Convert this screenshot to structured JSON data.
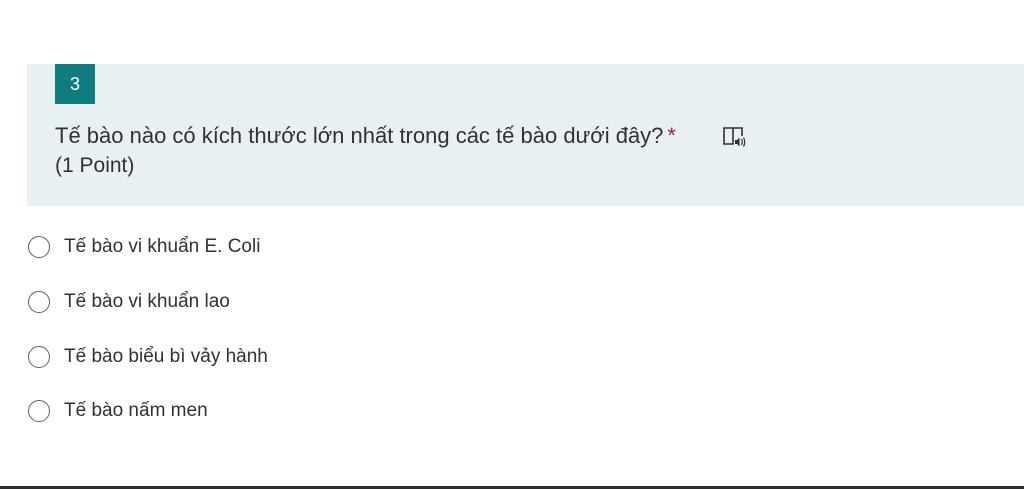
{
  "question": {
    "number": "3",
    "title": "Tế bào nào có kích thước lớn nhất trong các tế bào dưới đây?",
    "required_mark": "*",
    "points": "(1 Point)",
    "reader_icon": "immersive-reader-icon"
  },
  "options": [
    {
      "label": "Tế bào vi khuẩn E. Coli",
      "selected": false
    },
    {
      "label": "Tế bào vi khuẩn lao",
      "selected": false
    },
    {
      "label": "Tế bào biểu bì vảy hành",
      "selected": false
    },
    {
      "label": "Tế bào nấm men",
      "selected": false
    }
  ],
  "colors": {
    "accent": "#0f7d7e",
    "header_bg": "#e9f0f4",
    "required": "#a4262c"
  }
}
